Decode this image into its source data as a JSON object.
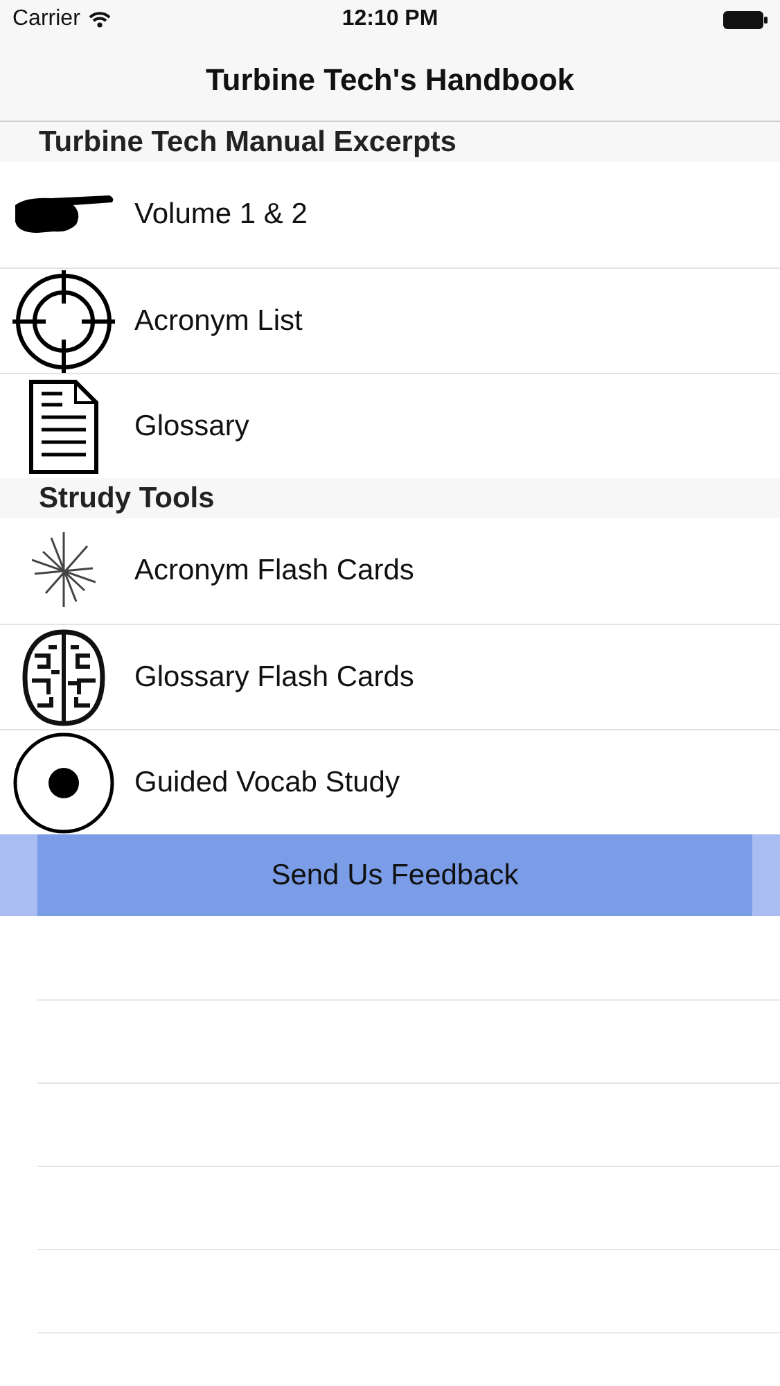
{
  "status_bar": {
    "carrier": "Carrier",
    "time": "12:10 PM"
  },
  "navigation_bar": {
    "title": "Turbine Tech's Handbook"
  },
  "sections": [
    {
      "header": "Turbine Tech Manual Excerpts",
      "items": [
        {
          "label": "Volume 1 & 2"
        },
        {
          "label": "Acronym List"
        },
        {
          "label": "Glossary"
        }
      ]
    },
    {
      "header": "Strudy Tools",
      "items": [
        {
          "label": "Acronym Flash Cards"
        },
        {
          "label": "Glossary Flash Cards"
        },
        {
          "label": "Guided Vocab Study"
        }
      ]
    }
  ],
  "feedback_button": {
    "label": "Send Us Feedback"
  }
}
